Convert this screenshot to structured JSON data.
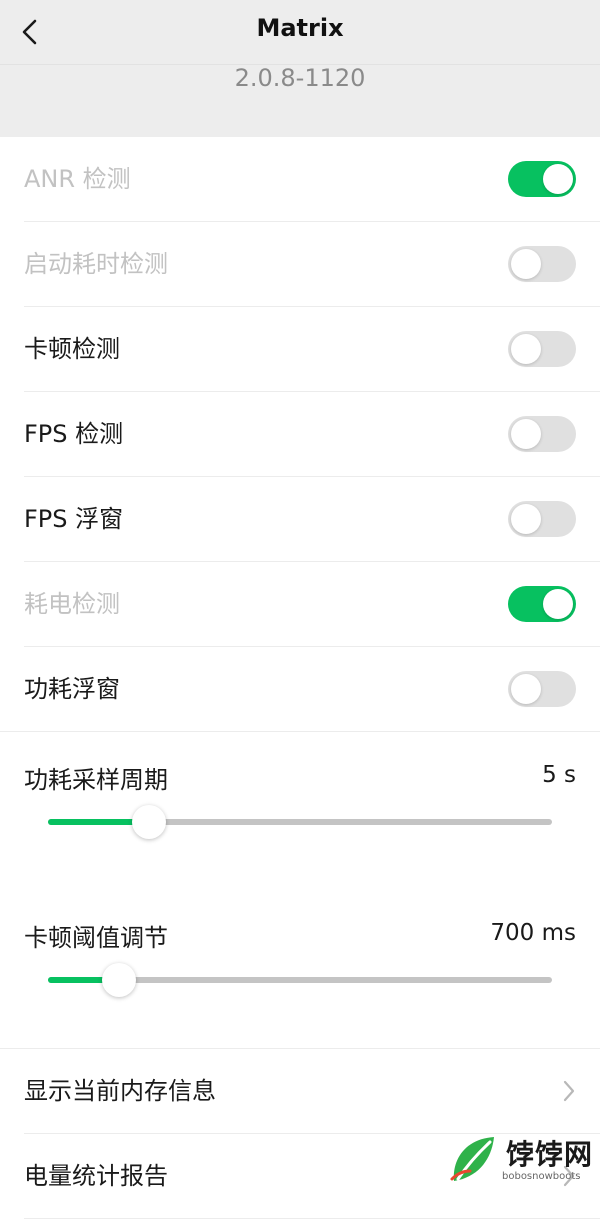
{
  "header": {
    "title": "Matrix",
    "version": "2.0.8-1120"
  },
  "toggles": [
    {
      "label": "ANR 检测",
      "on": true,
      "disabled": true
    },
    {
      "label": "启动耗时检测",
      "on": false,
      "disabled": true
    },
    {
      "label": "卡顿检测",
      "on": false,
      "disabled": false
    },
    {
      "label": "FPS 检测",
      "on": false,
      "disabled": false
    },
    {
      "label": "FPS 浮窗",
      "on": false,
      "disabled": false
    },
    {
      "label": "耗电检测",
      "on": true,
      "disabled": true
    },
    {
      "label": "功耗浮窗",
      "on": false,
      "disabled": false
    }
  ],
  "sliders": {
    "power_sample": {
      "label": "功耗采样周期",
      "value_text": "5 s",
      "fraction": 0.2
    },
    "lag_threshold": {
      "label": "卡顿阈值调节",
      "value_text": "700 ms",
      "fraction": 0.14
    }
  },
  "nav_items": [
    {
      "label": "显示当前内存信息"
    },
    {
      "label": "电量统计报告"
    }
  ],
  "watermark": {
    "brand": "饽饽网",
    "sub": "bobosnowboots"
  },
  "colors": {
    "accent": "#07c160",
    "toggle_off": "#e0e0e0",
    "header_bg": "#ededed",
    "disabled_text": "#c2c2c2"
  },
  "icons": {
    "back": "chevron-left-icon",
    "chevron": "chevron-right-icon",
    "watermark_logo": "leaf-logo-icon"
  }
}
